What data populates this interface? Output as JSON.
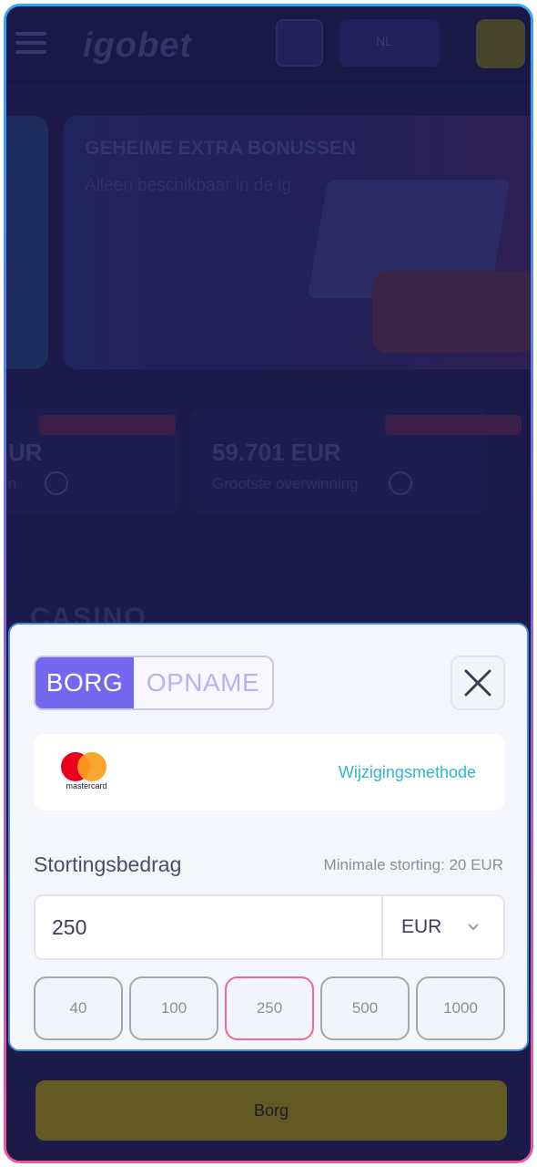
{
  "background": {
    "logo_text": "igobet",
    "language": "NL",
    "banner": {
      "title": "GEHEIME EXTRA BONUSSEN",
      "subtitle": "Alleen beschikbaar in de ig"
    },
    "stats": [
      {
        "value": "UR",
        "label": "n"
      },
      {
        "value": "59.701 EUR",
        "label": "Grootste overwinning"
      }
    ],
    "casino_tab": "CASINO",
    "borg_button": "Borg"
  },
  "modal": {
    "tabs": [
      {
        "label": "BORG",
        "active": true
      },
      {
        "label": "OPNAME",
        "active": false
      }
    ],
    "payment_method": {
      "brand_text": "mastercard",
      "change_label": "Wijzigingsmethode"
    },
    "amount_label": "Stortingsbedrag",
    "min_deposit": "Minimale storting: 20 EUR",
    "amount_value": "250",
    "currency": "EUR",
    "presets": [
      "40",
      "100",
      "250",
      "500",
      "1000"
    ],
    "selected_preset": "250"
  },
  "colors": {
    "accent": "#7468f0",
    "link": "#2fb6d6",
    "selected_border": "#e8699a",
    "overlay": "#1c1a4a"
  }
}
